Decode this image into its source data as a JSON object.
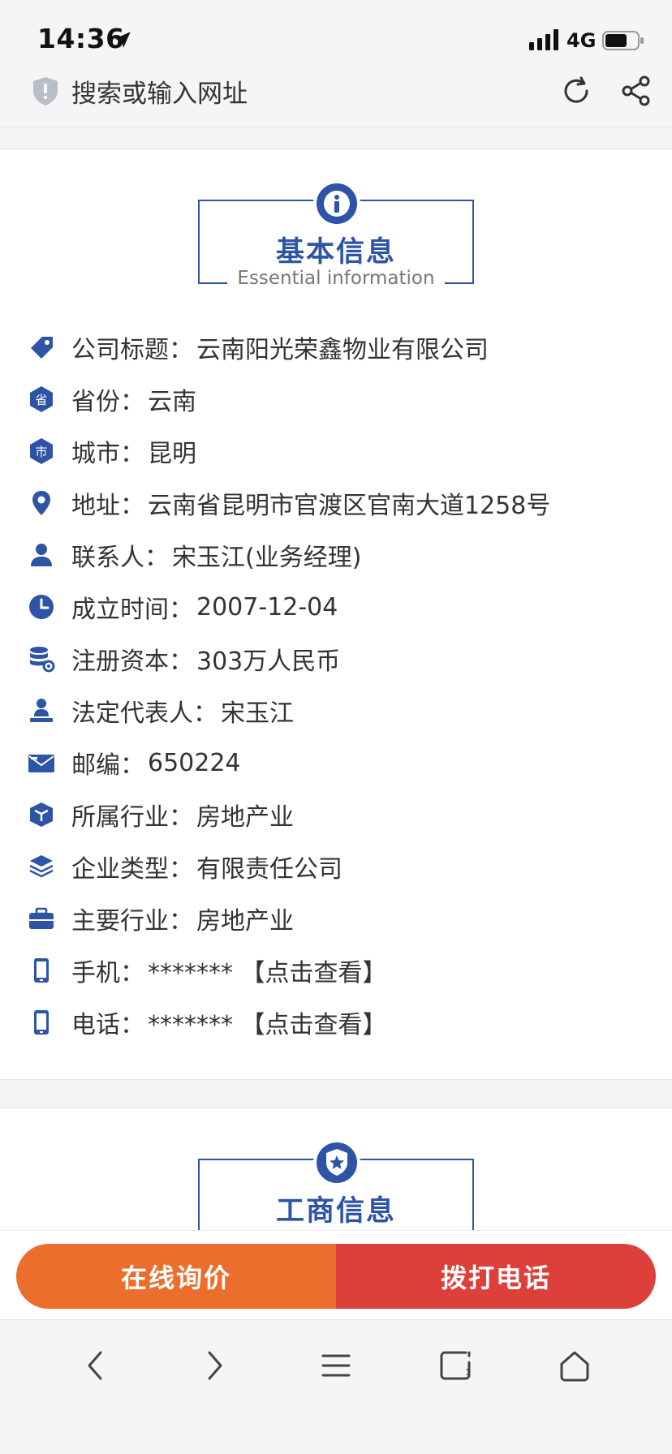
{
  "status_bar": {
    "time": "14:36",
    "network": "4G"
  },
  "browser": {
    "url_placeholder": "搜索或输入网址"
  },
  "section1": {
    "title": "基本信息",
    "subtitle": "Essential information"
  },
  "info": [
    {
      "icon": "tag-icon",
      "label": "公司标题：",
      "value": "云南阳光荣鑫物业有限公司"
    },
    {
      "icon": "province-icon",
      "label": "省份：",
      "value": "云南",
      "glyph": "省"
    },
    {
      "icon": "city-icon",
      "label": "城市：",
      "value": "昆明",
      "glyph": "市"
    },
    {
      "icon": "location-pin-icon",
      "label": "地址：",
      "value": "云南省昆明市官渡区官南大道1258号"
    },
    {
      "icon": "person-icon",
      "label": "联系人：",
      "value": "宋玉江(业务经理)"
    },
    {
      "icon": "clock-icon",
      "label": "成立时间：",
      "value": "2007-12-04"
    },
    {
      "icon": "database-gear-icon",
      "label": "注册资本：",
      "value": "303万人民币"
    },
    {
      "icon": "representative-icon",
      "label": "法定代表人：",
      "value": "宋玉江"
    },
    {
      "icon": "envelope-icon",
      "label": "邮编：",
      "value": "650224"
    },
    {
      "icon": "cube-icon",
      "label": "所属行业：",
      "value": "房地产业"
    },
    {
      "icon": "layers-icon",
      "label": "企业类型：",
      "value": "有限责任公司"
    },
    {
      "icon": "briefcase-icon",
      "label": "主要行业：",
      "value": "房地产业"
    },
    {
      "icon": "mobile-icon",
      "label": "手机：",
      "value": "******* 【点击查看】"
    },
    {
      "icon": "phone-icon",
      "label": "电话：",
      "value": "******* 【点击查看】"
    }
  ],
  "section2": {
    "title": "工商信息"
  },
  "actions": {
    "inquire": "在线询价",
    "call": "拨打电话"
  },
  "colors": {
    "primary_blue": "#2e54a6",
    "orange": "#ec6e2d",
    "red": "#dd3f3a"
  }
}
